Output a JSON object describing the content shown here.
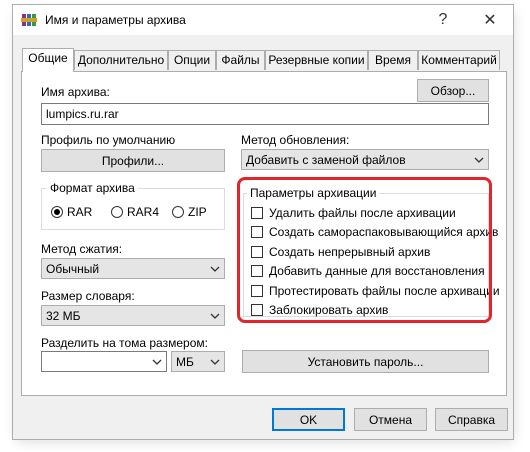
{
  "window": {
    "title": "Имя и параметры архива",
    "help_glyph": "?",
    "close_glyph": "✕"
  },
  "tabs": [
    {
      "label": "Общие"
    },
    {
      "label": "Дополнительно"
    },
    {
      "label": "Опции"
    },
    {
      "label": "Файлы"
    },
    {
      "label": "Резервные копии"
    },
    {
      "label": "Время"
    },
    {
      "label": "Комментарий"
    }
  ],
  "archive_name": {
    "label": "Имя архива:",
    "value": "lumpics.ru.rar",
    "browse_label": "Обзор..."
  },
  "profile": {
    "label": "Профиль по умолчанию",
    "button_label": "Профили..."
  },
  "update_method": {
    "label": "Метод обновления:",
    "value": "Добавить с заменой файлов"
  },
  "format": {
    "title": "Формат архива",
    "options": [
      "RAR",
      "RAR4",
      "ZIP"
    ],
    "selected": "RAR"
  },
  "compression": {
    "label": "Метод сжатия:",
    "value": "Обычный"
  },
  "dictionary": {
    "label": "Размер словаря:",
    "value": "32 МБ"
  },
  "split": {
    "label": "Разделить на тома размером:",
    "value": "",
    "unit": "МБ"
  },
  "archive_options": {
    "title": "Параметры архивации",
    "items": [
      {
        "label": "Удалить файлы после архивации",
        "checked": false
      },
      {
        "label": "Создать самораспаковывающийся архив",
        "checked": false
      },
      {
        "label": "Создать непрерывный архив",
        "checked": false
      },
      {
        "label": "Добавить данные для восстановления",
        "checked": false
      },
      {
        "label": "Протестировать файлы после архивации",
        "checked": false
      },
      {
        "label": "Заблокировать архив",
        "checked": false
      }
    ]
  },
  "password_button": "Установить пароль...",
  "footer": {
    "ok": "OK",
    "cancel": "Отмена",
    "help": "Справка"
  },
  "colors": {
    "highlight": "#e3242b",
    "ok_border": "#0078d7"
  }
}
